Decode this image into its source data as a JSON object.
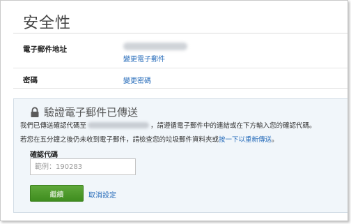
{
  "page": {
    "title": "安全性"
  },
  "email_row": {
    "label": "電子郵件地址",
    "change_link": "變更電子郵件"
  },
  "password_row": {
    "label": "密碼",
    "change_link": "變更密碼"
  },
  "verify": {
    "title": "驗證電子郵件已傳送",
    "line1_before": "我們已傳送確認代碼至",
    "line1_after": "，請遵循電子郵件中的連結或在下方輸入您的確認代碼。",
    "line2_before": "若您在五分鐘之後仍未收到電子郵件，請檢查您的垃圾郵件資料夾或",
    "line2_link": "按一下以重新傳送",
    "line2_after": "。",
    "code_label": "確認代碼",
    "code_placeholder": "範例：190283",
    "code_value": "",
    "continue_label": "繼續",
    "cancel_label": "取消設定"
  },
  "colors": {
    "link": "#2a6ebb",
    "button": "#4a9a28",
    "panel_bg": "#f1f6fa"
  },
  "icons": {
    "verify_title": "lock-icon"
  }
}
